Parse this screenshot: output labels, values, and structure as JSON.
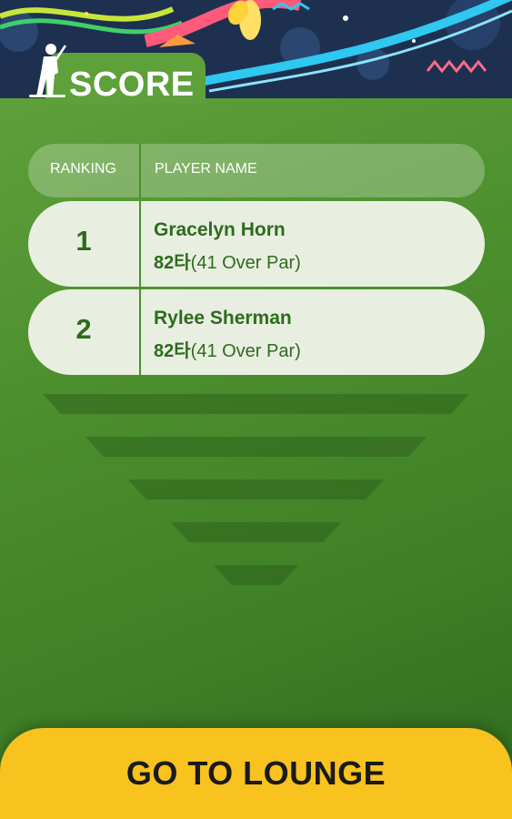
{
  "header": {
    "title": "SCORE",
    "icon": "golfer-icon"
  },
  "table": {
    "columns": [
      "RANKING",
      "PLAYER NAME"
    ],
    "rows": [
      {
        "rank": "1",
        "name": "Gracelyn Horn",
        "strokes": "82타",
        "detail": "(41 Over Par)"
      },
      {
        "rank": "2",
        "name": "Rylee Sherman",
        "strokes": "82타",
        "detail": "(41 Over Par)"
      }
    ]
  },
  "footer": {
    "button_label": "GO TO LOUNGE"
  },
  "colors": {
    "panel": "#4c8f2e",
    "text_green": "#2e6b1c",
    "button": "#f8c21f"
  }
}
